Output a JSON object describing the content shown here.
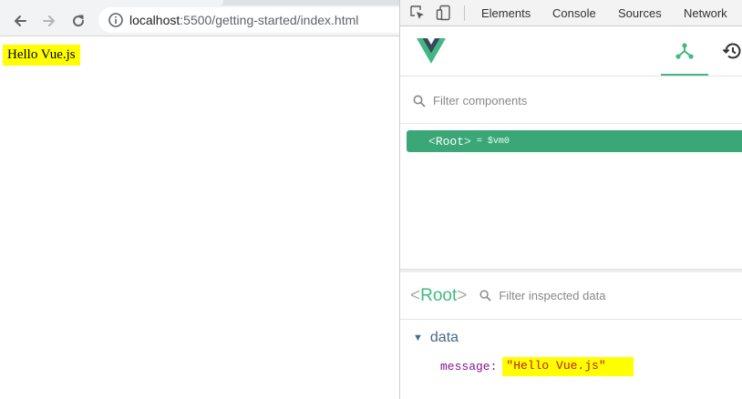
{
  "browser": {
    "url_host": "localhost",
    "url_rest": ":5500/getting-started/index.html",
    "page_text": "Hello Vue.js"
  },
  "devtools": {
    "tabs": [
      "Elements",
      "Console",
      "Sources",
      "Network"
    ],
    "vue": {
      "filter_components_placeholder": "Filter components",
      "root_component": {
        "open": "<",
        "name": "Root",
        "close": ">",
        "instance": "= $vm0"
      },
      "inspector": {
        "open": "<",
        "name": "Root",
        "close": ">",
        "filter_placeholder": "Filter inspected data",
        "section": {
          "label": "data",
          "arrow": "▼",
          "property": {
            "key": "message",
            "colon": ":",
            "value": "\"Hello Vue.js\""
          }
        }
      }
    }
  },
  "colors": {
    "vue_green": "#42b983",
    "selected_row": "#3ba776",
    "highlight": "#ffff00"
  }
}
